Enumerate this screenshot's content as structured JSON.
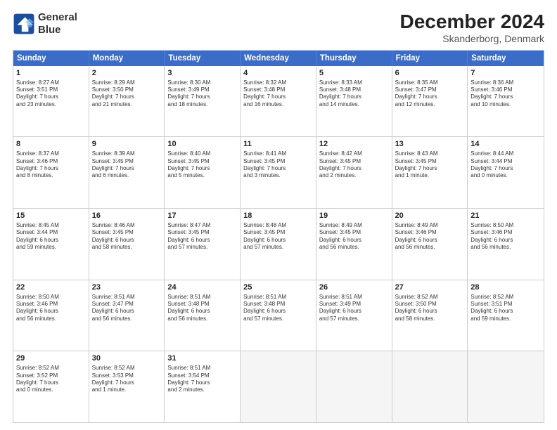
{
  "header": {
    "logo_line1": "General",
    "logo_line2": "Blue",
    "month": "December 2024",
    "location": "Skanderborg, Denmark"
  },
  "weekdays": [
    "Sunday",
    "Monday",
    "Tuesday",
    "Wednesday",
    "Thursday",
    "Friday",
    "Saturday"
  ],
  "rows": [
    [
      {
        "day": "1",
        "lines": [
          "Sunrise: 8:27 AM",
          "Sunset: 3:51 PM",
          "Daylight: 7 hours",
          "and 23 minutes."
        ]
      },
      {
        "day": "2",
        "lines": [
          "Sunrise: 8:29 AM",
          "Sunset: 3:50 PM",
          "Daylight: 7 hours",
          "and 21 minutes."
        ]
      },
      {
        "day": "3",
        "lines": [
          "Sunrise: 8:30 AM",
          "Sunset: 3:49 PM",
          "Daylight: 7 hours",
          "and 18 minutes."
        ]
      },
      {
        "day": "4",
        "lines": [
          "Sunrise: 8:32 AM",
          "Sunset: 3:48 PM",
          "Daylight: 7 hours",
          "and 16 minutes."
        ]
      },
      {
        "day": "5",
        "lines": [
          "Sunrise: 8:33 AM",
          "Sunset: 3:48 PM",
          "Daylight: 7 hours",
          "and 14 minutes."
        ]
      },
      {
        "day": "6",
        "lines": [
          "Sunrise: 8:35 AM",
          "Sunset: 3:47 PM",
          "Daylight: 7 hours",
          "and 12 minutes."
        ]
      },
      {
        "day": "7",
        "lines": [
          "Sunrise: 8:36 AM",
          "Sunset: 3:46 PM",
          "Daylight: 7 hours",
          "and 10 minutes."
        ]
      }
    ],
    [
      {
        "day": "8",
        "lines": [
          "Sunrise: 8:37 AM",
          "Sunset: 3:46 PM",
          "Daylight: 7 hours",
          "and 8 minutes."
        ]
      },
      {
        "day": "9",
        "lines": [
          "Sunrise: 8:39 AM",
          "Sunset: 3:45 PM",
          "Daylight: 7 hours",
          "and 6 minutes."
        ]
      },
      {
        "day": "10",
        "lines": [
          "Sunrise: 8:40 AM",
          "Sunset: 3:45 PM",
          "Daylight: 7 hours",
          "and 5 minutes."
        ]
      },
      {
        "day": "11",
        "lines": [
          "Sunrise: 8:41 AM",
          "Sunset: 3:45 PM",
          "Daylight: 7 hours",
          "and 3 minutes."
        ]
      },
      {
        "day": "12",
        "lines": [
          "Sunrise: 8:42 AM",
          "Sunset: 3:45 PM",
          "Daylight: 7 hours",
          "and 2 minutes."
        ]
      },
      {
        "day": "13",
        "lines": [
          "Sunrise: 8:43 AM",
          "Sunset: 3:45 PM",
          "Daylight: 7 hours",
          "and 1 minute."
        ]
      },
      {
        "day": "14",
        "lines": [
          "Sunrise: 8:44 AM",
          "Sunset: 3:44 PM",
          "Daylight: 7 hours",
          "and 0 minutes."
        ]
      }
    ],
    [
      {
        "day": "15",
        "lines": [
          "Sunrise: 8:45 AM",
          "Sunset: 3:44 PM",
          "Daylight: 6 hours",
          "and 59 minutes."
        ]
      },
      {
        "day": "16",
        "lines": [
          "Sunrise: 8:46 AM",
          "Sunset: 3:45 PM",
          "Daylight: 6 hours",
          "and 58 minutes."
        ]
      },
      {
        "day": "17",
        "lines": [
          "Sunrise: 8:47 AM",
          "Sunset: 3:45 PM",
          "Daylight: 6 hours",
          "and 57 minutes."
        ]
      },
      {
        "day": "18",
        "lines": [
          "Sunrise: 8:48 AM",
          "Sunset: 3:45 PM",
          "Daylight: 6 hours",
          "and 57 minutes."
        ]
      },
      {
        "day": "19",
        "lines": [
          "Sunrise: 8:49 AM",
          "Sunset: 3:45 PM",
          "Daylight: 6 hours",
          "and 56 minutes."
        ]
      },
      {
        "day": "20",
        "lines": [
          "Sunrise: 8:49 AM",
          "Sunset: 3:46 PM",
          "Daylight: 6 hours",
          "and 56 minutes."
        ]
      },
      {
        "day": "21",
        "lines": [
          "Sunrise: 8:50 AM",
          "Sunset: 3:46 PM",
          "Daylight: 6 hours",
          "and 56 minutes."
        ]
      }
    ],
    [
      {
        "day": "22",
        "lines": [
          "Sunrise: 8:50 AM",
          "Sunset: 3:46 PM",
          "Daylight: 6 hours",
          "and 56 minutes."
        ]
      },
      {
        "day": "23",
        "lines": [
          "Sunrise: 8:51 AM",
          "Sunset: 3:47 PM",
          "Daylight: 6 hours",
          "and 56 minutes."
        ]
      },
      {
        "day": "24",
        "lines": [
          "Sunrise: 8:51 AM",
          "Sunset: 3:48 PM",
          "Daylight: 6 hours",
          "and 56 minutes."
        ]
      },
      {
        "day": "25",
        "lines": [
          "Sunrise: 8:51 AM",
          "Sunset: 3:48 PM",
          "Daylight: 6 hours",
          "and 57 minutes."
        ]
      },
      {
        "day": "26",
        "lines": [
          "Sunrise: 8:51 AM",
          "Sunset: 3:49 PM",
          "Daylight: 6 hours",
          "and 57 minutes."
        ]
      },
      {
        "day": "27",
        "lines": [
          "Sunrise: 8:52 AM",
          "Sunset: 3:50 PM",
          "Daylight: 6 hours",
          "and 58 minutes."
        ]
      },
      {
        "day": "28",
        "lines": [
          "Sunrise: 8:52 AM",
          "Sunset: 3:51 PM",
          "Daylight: 6 hours",
          "and 59 minutes."
        ]
      }
    ],
    [
      {
        "day": "29",
        "lines": [
          "Sunrise: 8:52 AM",
          "Sunset: 3:52 PM",
          "Daylight: 7 hours",
          "and 0 minutes."
        ]
      },
      {
        "day": "30",
        "lines": [
          "Sunrise: 8:52 AM",
          "Sunset: 3:53 PM",
          "Daylight: 7 hours",
          "and 1 minute."
        ]
      },
      {
        "day": "31",
        "lines": [
          "Sunrise: 8:51 AM",
          "Sunset: 3:54 PM",
          "Daylight: 7 hours",
          "and 2 minutes."
        ]
      },
      null,
      null,
      null,
      null
    ]
  ]
}
